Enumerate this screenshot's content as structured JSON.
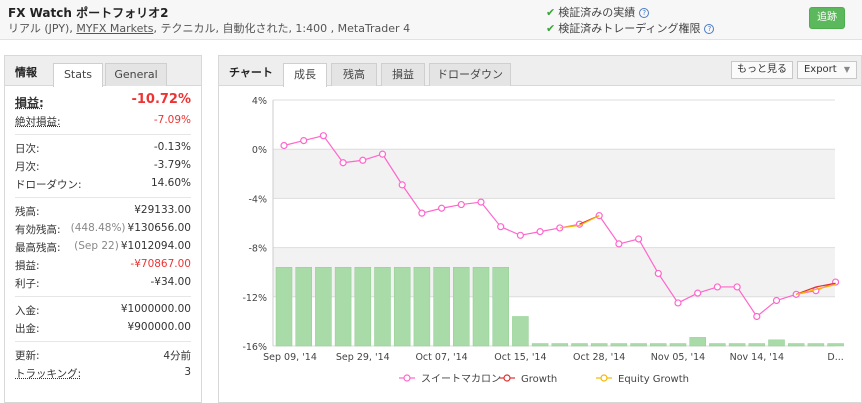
{
  "header": {
    "title": "FX Watch ポートフォリオ2",
    "subtitle_prefix": "リアル (JPY), ",
    "broker_link": "MYFX Markets",
    "subtitle_suffix": ", テクニカル, 自動化された, 1:400 , MetaTrader 4",
    "verified_track_record": "検証済みの実績",
    "verified_trading_privileges": "検証済みトレーディング権限",
    "help_glyph": "?",
    "track_button": "追跡"
  },
  "left_panel": {
    "tab_title": "情報",
    "tabs": [
      "Stats",
      "General"
    ],
    "active_tab": "Stats",
    "gain": {
      "label": "損益:",
      "value": "-10.72%"
    },
    "abs_gain": {
      "label": "絶対損益:",
      "value": "-7.09%"
    },
    "daily": {
      "label": "日次:",
      "value": "-0.13%"
    },
    "monthly": {
      "label": "月次:",
      "value": "-3.79%"
    },
    "drawdown": {
      "label": "ドローダウン:",
      "value": "14.60%"
    },
    "balance": {
      "label": "残高:",
      "value": "¥29133.00"
    },
    "equity": {
      "label": "有効残高:",
      "sub": "(448.48%)",
      "value": "¥130656.00"
    },
    "highest": {
      "label": "最高残高:",
      "sub": "(Sep 22)",
      "value": "¥1012094.00"
    },
    "profit": {
      "label": "損益:",
      "value": "-¥70867.00"
    },
    "interest": {
      "label": "利子:",
      "value": "-¥34.00"
    },
    "deposits": {
      "label": "入金:",
      "value": "¥1000000.00"
    },
    "withdrawals": {
      "label": "出金:",
      "value": "¥900000.00"
    },
    "updated": {
      "label": "更新:",
      "value": "4分前"
    },
    "tracking": {
      "label": "トラッキング:",
      "value": "3"
    }
  },
  "chart_panel": {
    "tab_title": "チャート",
    "tabs": [
      "成長",
      "残高",
      "損益",
      "ドローダウン"
    ],
    "active_tab": "成長",
    "more_button": "もっと見る",
    "export_button": "Export",
    "export_arrow": "▼"
  },
  "chart_data": {
    "type": "line",
    "y_ticks": [
      "4%",
      "0%",
      "-4%",
      "-8%",
      "-12%",
      "-16%"
    ],
    "ylim": [
      -16,
      4
    ],
    "x_ticks": [
      "Sep 09, '14",
      "Sep 29, '14",
      "Oct 07, '14",
      "Oct 15, '14",
      "Oct 28, '14",
      "Nov 05, '14",
      "Nov 14, '14",
      "D..."
    ],
    "grid": true,
    "legend_position": "bottom",
    "series": [
      {
        "name": "スイートマカロン",
        "color": "#ff66cc",
        "values": [
          0.3,
          0.7,
          1.1,
          -1.1,
          -0.9,
          -0.4,
          -2.9,
          -5.2,
          -4.8,
          -4.5,
          -4.3,
          -6.3,
          -7.0,
          -6.7,
          -6.4,
          -6.1,
          -5.4,
          -7.7,
          -7.3,
          -10.1,
          -12.5,
          -11.7,
          -11.2,
          -11.2,
          -13.6,
          -12.3,
          -11.8,
          -11.5,
          -10.8
        ]
      },
      {
        "name": "Growth",
        "color": "#e03030",
        "values": [
          null,
          null,
          null,
          null,
          null,
          null,
          null,
          null,
          null,
          null,
          null,
          null,
          null,
          null,
          null,
          -6.1,
          -5.4,
          null,
          null,
          null,
          null,
          null,
          null,
          null,
          null,
          null,
          -11.8,
          -11.2,
          -10.9
        ]
      },
      {
        "name": "Equity Growth",
        "color": "#f5b800",
        "values": [
          null,
          null,
          null,
          null,
          null,
          null,
          null,
          null,
          null,
          null,
          null,
          null,
          null,
          null,
          -6.4,
          -6.2,
          -5.4,
          null,
          null,
          null,
          null,
          null,
          null,
          null,
          null,
          null,
          -11.8,
          -11.4,
          -11.0
        ]
      }
    ],
    "volume_bars": {
      "color": "#a8dba8",
      "levels": [
        0.32,
        0.32,
        0.32,
        0.32,
        0.32,
        0.32,
        0.32,
        0.32,
        0.32,
        0.32,
        0.32,
        0.32,
        0.12,
        0.01,
        0.01,
        0.01,
        0.01,
        0.01,
        0.01,
        0.01,
        0.01,
        0.035,
        0.01,
        0.01,
        0.01,
        0.025,
        0.01,
        0.01,
        0.01
      ]
    }
  }
}
